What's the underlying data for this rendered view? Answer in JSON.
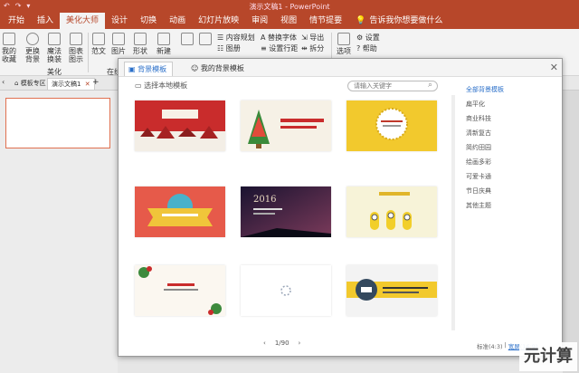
{
  "app": {
    "title": "演示文稿1 - PowerPoint",
    "qat": [
      "↶",
      "↷",
      "▾"
    ]
  },
  "menu": {
    "tabs": [
      "开始",
      "插入",
      "美化大师",
      "设计",
      "切换",
      "动画",
      "幻灯片放映",
      "审阅",
      "视图",
      "情节提要"
    ],
    "active": "美化大师",
    "tellme": "告诉我你想要做什么"
  },
  "ribbon": {
    "left_group_labels": [
      "我的\n收藏",
      "更换\n背景",
      "魔法\n换装",
      "图表\n图示"
    ],
    "group_label_meihua": "美化",
    "group_label_zaixian": "在线",
    "mid_labels": [
      "范文",
      "图片",
      "形状"
    ],
    "right_small": [
      "内容规划",
      "图册",
      "替换字体",
      "设置行距",
      "导出",
      "拆分"
    ],
    "far_right": [
      "设置",
      "帮助",
      "选项"
    ],
    "far_right_icon_label": "新建"
  },
  "doctabs": {
    "tabs": [
      "模板专区",
      "演示文稿1"
    ]
  },
  "dialog": {
    "tabs": [
      "背景模板",
      "我的背景模板"
    ],
    "active_tab": "背景模板",
    "subheader": "选择本地模板",
    "search_placeholder": "请输入关键字",
    "categories": [
      "全部背景模板",
      "扁平化",
      "商业科技",
      "清新复古",
      "简约田园",
      "绘画多彩",
      "可爱卡通",
      "节日庆典",
      "其他主题"
    ],
    "active_category": "全部背景模板",
    "pager": {
      "prev": "‹",
      "page": "1/90",
      "next": "›"
    },
    "ratios": {
      "standard": "标准(4:3)",
      "sep": "|",
      "wide": "宽屏(16:9)"
    }
  },
  "cards": [
    {
      "caption": "",
      "theme": "christmas-village"
    },
    {
      "caption": "",
      "theme": "christmas-tree"
    },
    {
      "caption": "",
      "theme": "yellow-circle"
    },
    {
      "caption": "",
      "theme": "red-ribbon"
    },
    {
      "caption": "2016",
      "theme": "starry-night"
    },
    {
      "caption": "",
      "theme": "minions"
    },
    {
      "caption": "",
      "theme": "holly-floral"
    },
    {
      "caption": "",
      "theme": "loading"
    },
    {
      "caption": "",
      "theme": "business-yellow"
    }
  ],
  "watermark": "元计算",
  "colors": {
    "accent": "#b7472a",
    "link_blue": "#2a6fc9"
  }
}
